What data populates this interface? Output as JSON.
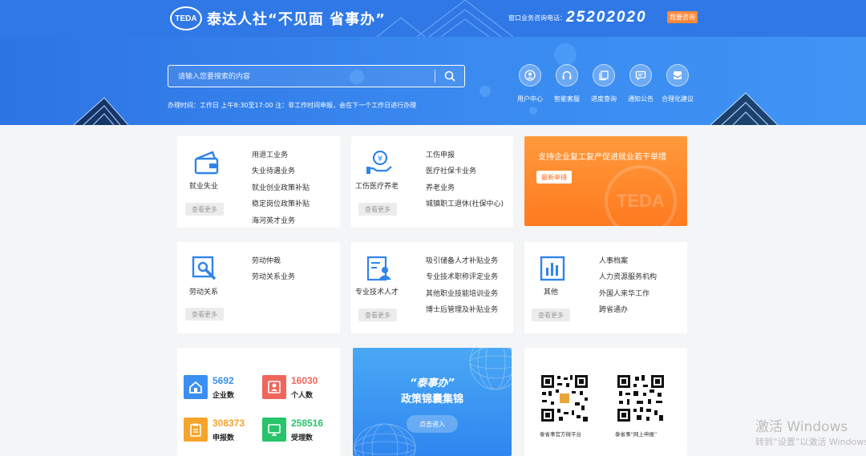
{
  "header": {
    "logo_mark": "TEDA",
    "logo_text": "泰达人社“不见面 省事办”",
    "hotline_label": "窗口业务咨询电话：",
    "hotline_number": "25202020",
    "consult_label": "我要咨询"
  },
  "search": {
    "placeholder": "请输入您要搜索的内容",
    "hours": "办理时间：工作日 上午8:30至17:00 注：非工作时间申报，会在下一个工作日进行办理"
  },
  "quick_links": [
    {
      "label": "用户中心",
      "icon": "user-icon"
    },
    {
      "label": "智能客服",
      "icon": "headset-icon"
    },
    {
      "label": "进度查询",
      "icon": "copy-icon"
    },
    {
      "label": "通知公告",
      "icon": "message-icon"
    },
    {
      "label": "合理化建议",
      "icon": "mail-icon"
    }
  ],
  "services": [
    {
      "title": "就业失业",
      "icon": "wallet-icon",
      "more": "查看更多",
      "items": [
        "用退工业务",
        "失业待遇业务",
        "就业创业政策补贴",
        "稳定岗位政策补贴",
        "海河英才业务"
      ]
    },
    {
      "title": "工伤医疗养老",
      "icon": "hand-coin-icon",
      "more": "查看更多",
      "items": [
        "工伤申报",
        "医疗社保卡业务",
        "养老业务",
        "城镇职工退休(社保中心)"
      ]
    },
    {
      "title": "劳动关系",
      "icon": "wrench-icon",
      "more": "查看更多",
      "items": [
        "劳动仲裁",
        "劳动关系业务"
      ]
    },
    {
      "title": "专业技术人才",
      "icon": "certificate-icon",
      "more": "查看更多",
      "items": [
        "吸引储备人才补贴业务",
        "专业技术职称评定业务",
        "其他职业技能培训业务",
        "博士后管理及补贴业务"
      ]
    },
    {
      "title": "其他",
      "icon": "chart-icon",
      "more": "查看更多",
      "items": [
        "人事档案",
        "人力资源服务机构",
        "外国人来华工作",
        "跨省通办"
      ]
    }
  ],
  "promo": {
    "title": "支持企业复工复产促进就业若干举措",
    "tag": "最新举措",
    "watermark": "TEDA"
  },
  "stats": [
    {
      "value": "5692",
      "label": "企业数",
      "color": "#3b8ff0",
      "icon": "house-icon"
    },
    {
      "value": "16030",
      "label": "个人数",
      "color": "#f0665c",
      "icon": "person-icon"
    },
    {
      "value": "308373",
      "label": "申报数",
      "color": "#f5a52b",
      "icon": "clipboard-icon"
    },
    {
      "value": "258516",
      "label": "受理数",
      "color": "#27c46b",
      "icon": "monitor-icon"
    }
  ],
  "policy": {
    "line1": "“泰事办”",
    "line2": "政策锦囊集锦",
    "button": "点击进入"
  },
  "qr": [
    {
      "caption": "泰省事官方微平台"
    },
    {
      "caption": "泰省事“网上申报”"
    }
  ],
  "watermark": {
    "line1": "激活 Windows",
    "line2": "转到“设置”以激活 Windows。"
  }
}
